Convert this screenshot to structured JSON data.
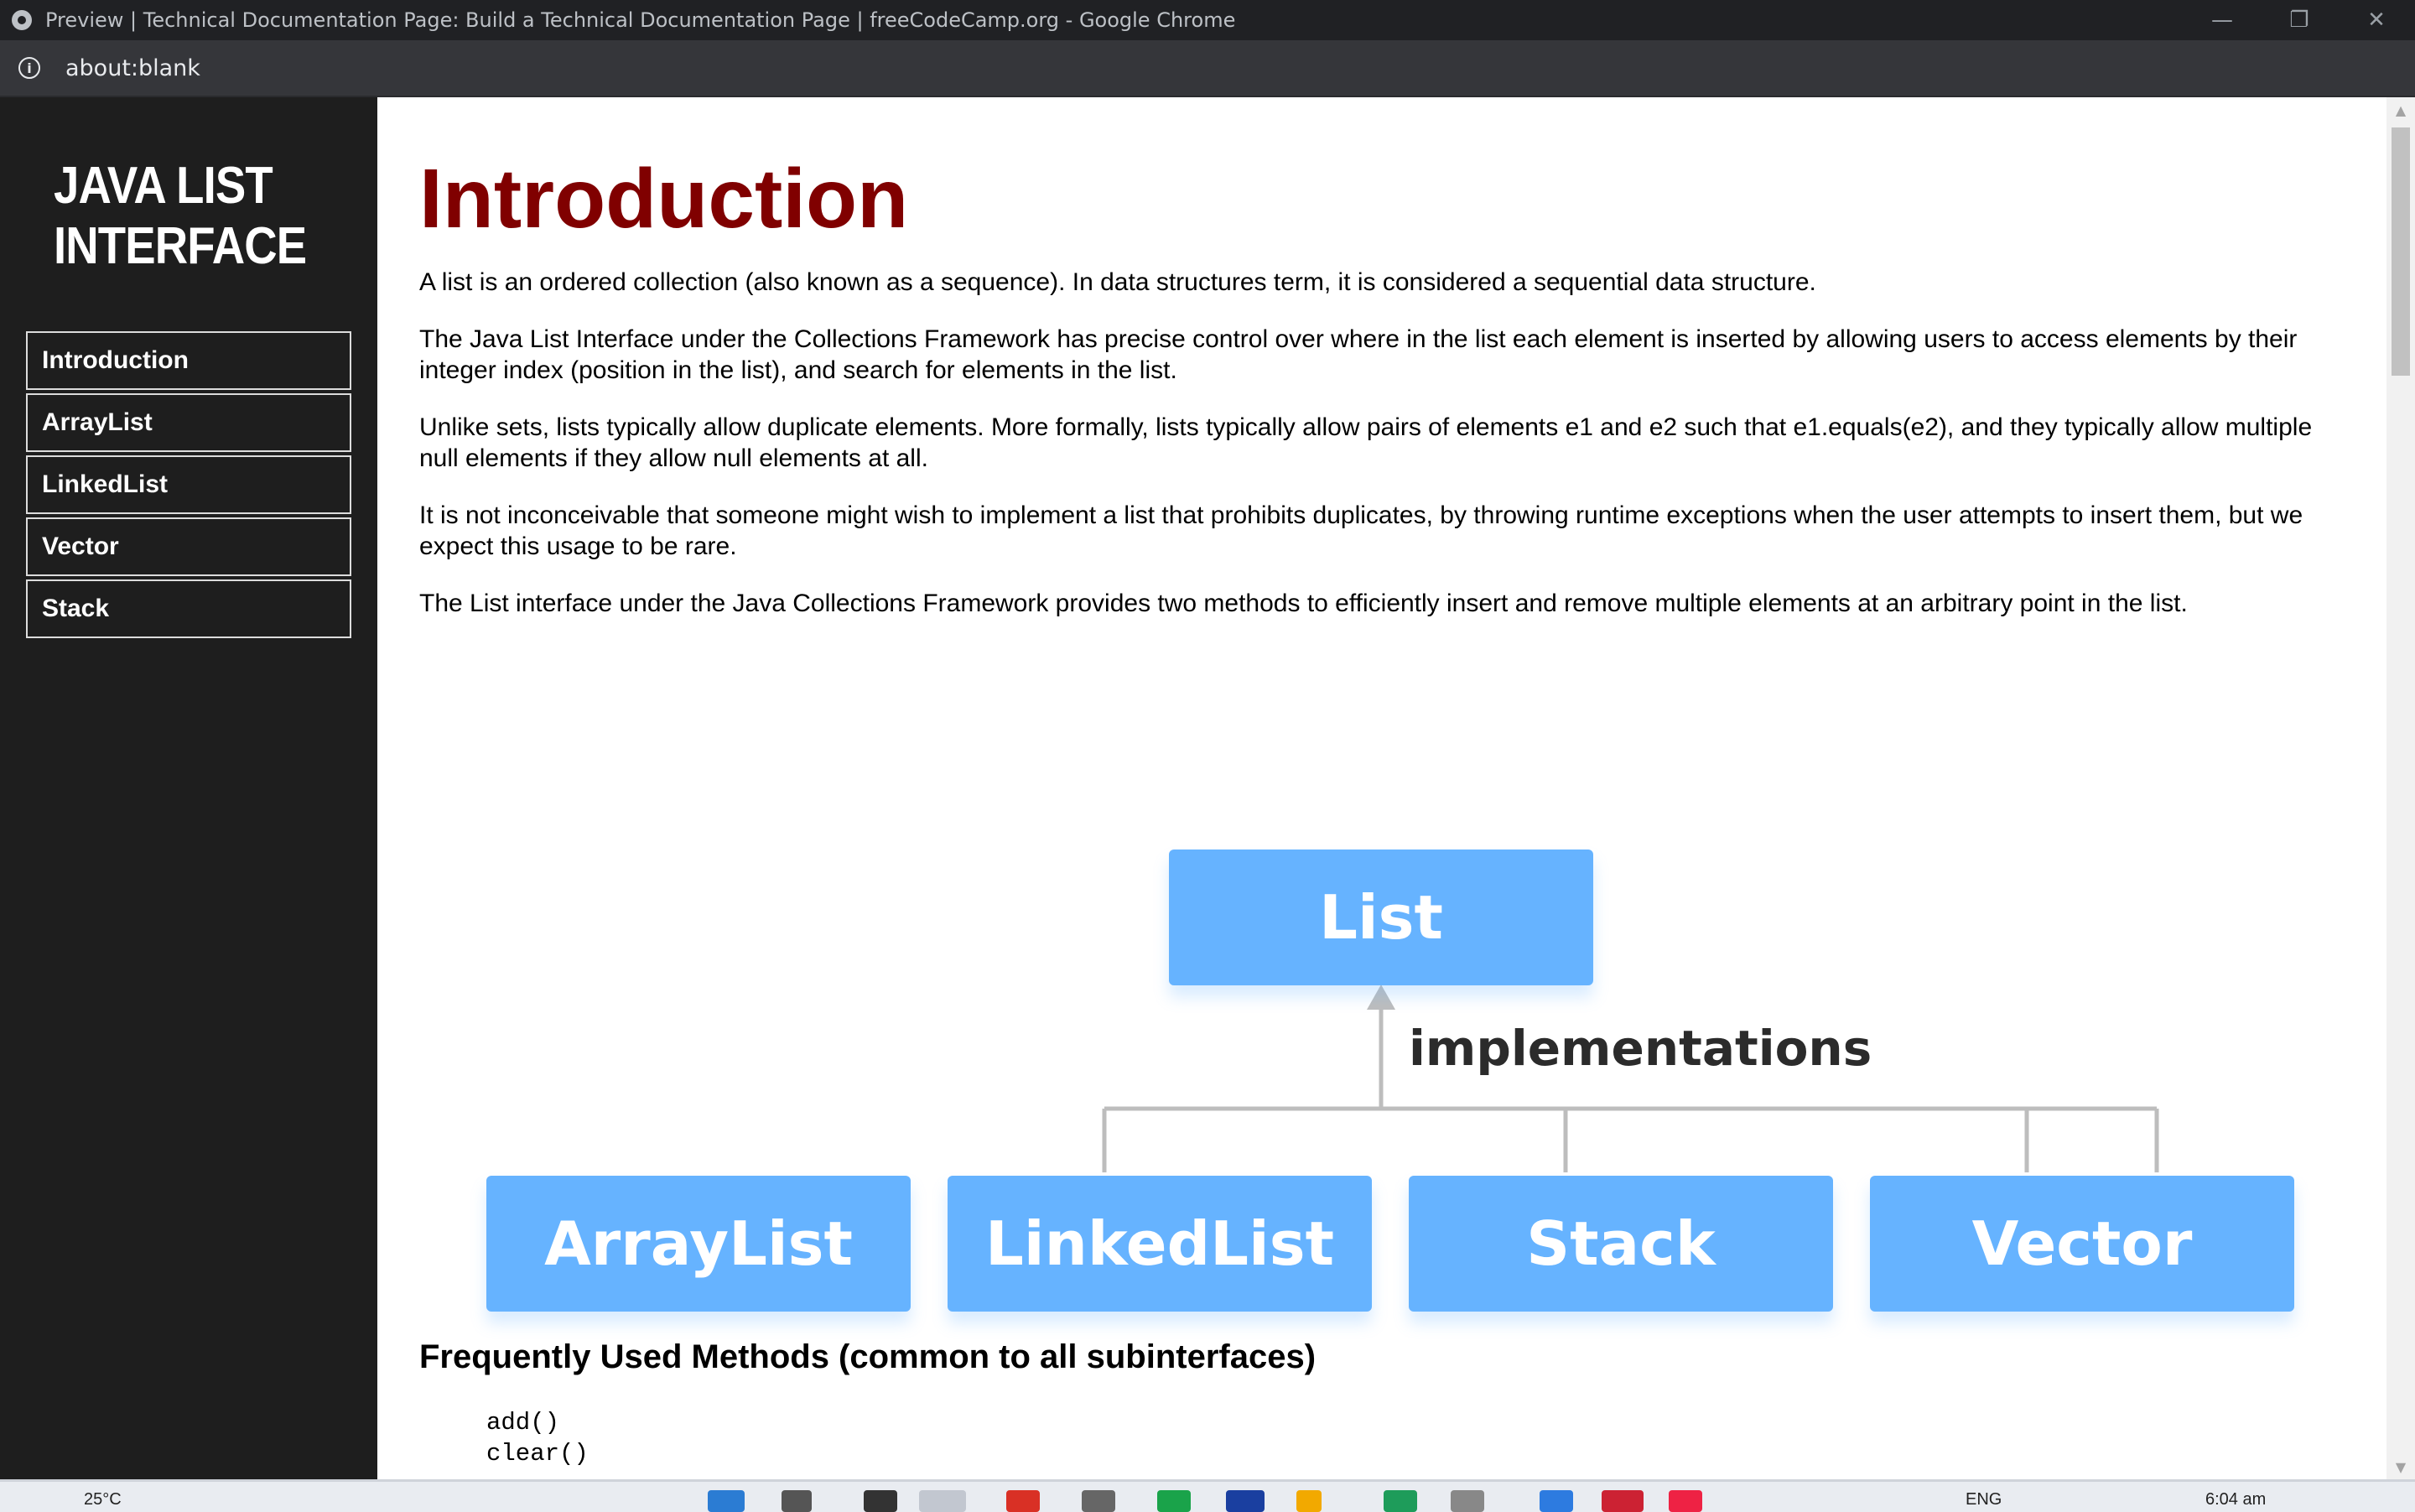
{
  "window": {
    "title": "Preview | Technical Documentation Page: Build a Technical Documentation Page | freeCodeCamp.org - Google Chrome",
    "minimize": "—",
    "restore": "❐",
    "close": "✕"
  },
  "addressbar": {
    "url": "about:blank",
    "info_icon": "i"
  },
  "sidebar": {
    "title": "JAVA LIST INTERFACE",
    "items": [
      {
        "label": "Introduction"
      },
      {
        "label": "ArrayList"
      },
      {
        "label": "LinkedList"
      },
      {
        "label": "Vector"
      },
      {
        "label": "Stack"
      }
    ]
  },
  "main": {
    "heading": "Introduction",
    "paragraphs": [
      "A list is an ordered collection (also known as a sequence). In data structures term, it is considered a sequential data structure.",
      "The Java List Interface under the Collections Framework has precise control over where in the list each element is inserted by allowing users to access elements by their integer index (position in the list), and search for elements in the list.",
      "Unlike sets, lists typically allow duplicate elements. More formally, lists typically allow pairs of elements e1 and e2 such that e1.equals(e2), and they typically allow multiple null elements if they allow null elements at all.",
      "It is not inconceivable that someone might wish to implement a list that prohibits duplicates, by throwing runtime exceptions when the user attempts to insert them, but we expect this usage to be rare.",
      "The List interface under the Java Collections Framework provides two methods to efficiently insert and remove multiple elements at an arbitrary point in the list."
    ],
    "diagram": {
      "root": "List",
      "relation": "implementations",
      "children": [
        "ArrayList",
        "LinkedList",
        "Stack",
        "Vector"
      ]
    },
    "subheading": "Frequently Used Methods (common to all subinterfaces)",
    "methods": [
      "add()",
      "clear()"
    ]
  },
  "taskbar": {
    "weather": "25°C",
    "language": "ENG",
    "time": "6:04 am"
  }
}
